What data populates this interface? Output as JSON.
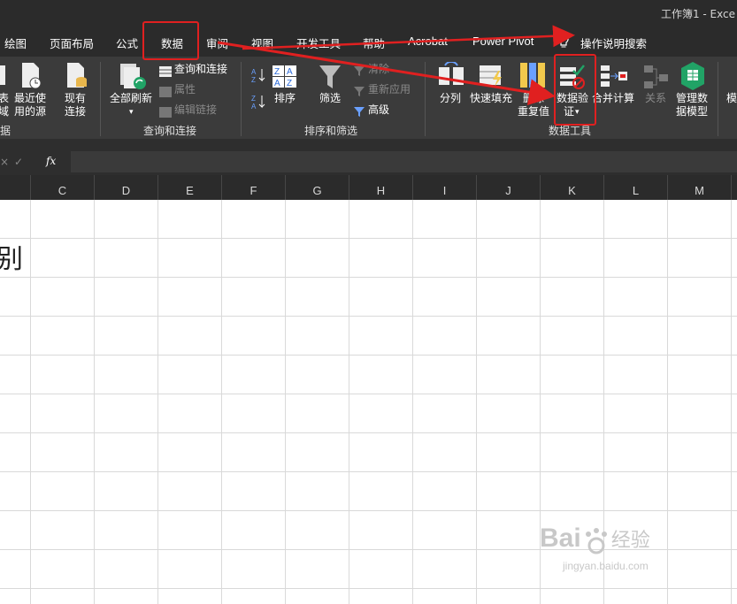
{
  "window": {
    "title": "工作簿1  -  Exce"
  },
  "tabs": [
    {
      "label": "绘图"
    },
    {
      "label": "页面布局"
    },
    {
      "label": "公式"
    },
    {
      "label": "数据"
    },
    {
      "label": "审阅"
    },
    {
      "label": "视图"
    },
    {
      "label": "开发工具"
    },
    {
      "label": "帮助"
    },
    {
      "label": "Acrobat"
    },
    {
      "label": "Power Pivot"
    }
  ],
  "tell_me": {
    "label": "操作说明搜索",
    "icon": "lightbulb-icon"
  },
  "ribbon": {
    "get_data": {
      "btn1": "表",
      "btn1b": "域",
      "btn2": "最近使",
      "btn2b": "用的源",
      "btn3": "现有",
      "btn3b": "连接",
      "group": "据"
    },
    "queries": {
      "refresh_all": "全部刷新",
      "queries_connections": "查询和连接",
      "properties": "属性",
      "edit_links": "编辑链接",
      "group": "查询和连接"
    },
    "sort_filter": {
      "sort": "排序",
      "filter": "筛选",
      "clear": "清除",
      "reapply": "重新应用",
      "advanced": "高级",
      "group": "排序和筛选"
    },
    "data_tools": {
      "text_to_columns": "分列",
      "flash_fill": "快速填充",
      "remove_dup_1": "删除",
      "remove_dup_2": "重复值",
      "data_validation_1": "数据验",
      "data_validation_2": "证",
      "consolidate": "合并计算",
      "relationships": "关系",
      "manage_model_1": "管理数",
      "manage_model_2": "据模型",
      "group": "数据工具"
    },
    "forecast": {
      "partial": "模"
    }
  },
  "formula_bar": {
    "cancel": "×",
    "confirm": "✓",
    "fx": "fx",
    "value": ""
  },
  "columns": [
    "C",
    "D",
    "E",
    "F",
    "G",
    "H",
    "I",
    "J",
    "K",
    "L",
    "M"
  ],
  "cell_content": {
    "partial_char": "别"
  },
  "watermark": {
    "line1": "Bai",
    "line2": "经验",
    "line3": "jingyan.baidu.com"
  },
  "colors": {
    "highlight": "#e02020",
    "accent_green": "#21a366",
    "dark_bg": "#2b2b2b"
  }
}
